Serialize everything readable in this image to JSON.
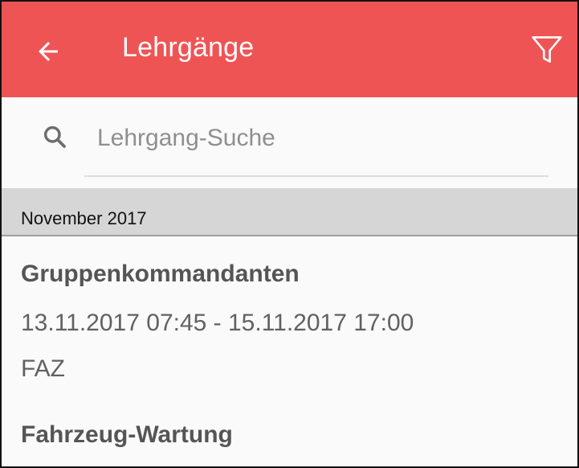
{
  "appbar": {
    "title": "Lehrgänge",
    "back_icon": "arrow-back-icon",
    "filter_icon": "filter-funnel-icon",
    "color": "#ef5455"
  },
  "search": {
    "placeholder": "Lehrgang-Suche",
    "value": ""
  },
  "section": {
    "label": "November 2017"
  },
  "courses": [
    {
      "title": "Gruppenkommandanten",
      "date_range": "13.11.2017 07:45 - 15.11.2017 17:00",
      "location": "FAZ"
    },
    {
      "title": "Fahrzeug-Wartung",
      "date_range": "",
      "location": ""
    }
  ]
}
